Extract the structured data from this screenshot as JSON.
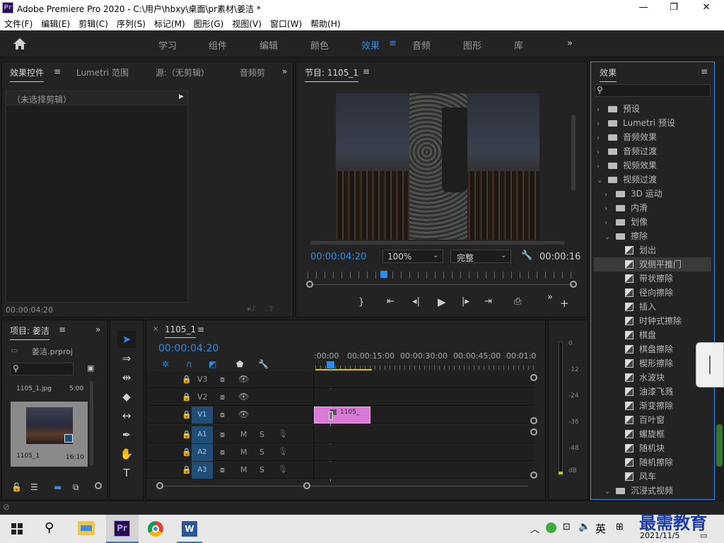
{
  "window": {
    "title": "Adobe Premiere Pro 2020 - C:\\用户\\hbxy\\桌面\\pr素材\\姜洁 *",
    "logo": "Pr"
  },
  "menu": [
    "文件(F)",
    "编辑(E)",
    "剪辑(C)",
    "序列(S)",
    "标记(M)",
    "图形(G)",
    "视图(V)",
    "窗口(W)",
    "帮助(H)"
  ],
  "workspaces": [
    "学习",
    "组件",
    "编辑",
    "颜色",
    "效果",
    "音频",
    "图形",
    "库"
  ],
  "source_panel": {
    "tabs": [
      "效果控件",
      "Lumetri 范围",
      "源:（无剪辑）",
      "音频剪"
    ],
    "no_clip": "（未选择剪辑）",
    "timecode": "00:00:04:20"
  },
  "program": {
    "title": "节目: 1105_1",
    "timecode": "00:00:04:20",
    "zoom": "100%",
    "quality": "完整",
    "duration": "00:00:16"
  },
  "project": {
    "title": "项目: 姜洁",
    "file": "姜洁.prproj",
    "thumb1_name": "1105_1.jpg",
    "thumb1_dur": "5:00",
    "thumb2_name": "1105_1",
    "thumb2_dur": "16:10"
  },
  "timeline": {
    "seq": "1105_1",
    "timecode": "00:00:04:20",
    "ruler": [
      ":00:00",
      "00:00:15:00",
      "00:00:30:00",
      "00:00:45:00",
      "00:01:0"
    ],
    "video_tracks": [
      "V3",
      "V2",
      "V1"
    ],
    "audio_tracks": [
      "A1",
      "A2",
      "A3"
    ],
    "clip_label": "1105_",
    "m": "M",
    "s": "S"
  },
  "meter": {
    "labels": [
      "0",
      "-12",
      "-24",
      "-36",
      "-48",
      "dB"
    ]
  },
  "effects": {
    "title": "效果",
    "items": [
      {
        "label": "预设",
        "level": 0,
        "kind": "preset"
      },
      {
        "label": "Lumetri 预设",
        "level": 0,
        "kind": "preset"
      },
      {
        "label": "音频效果",
        "level": 0,
        "kind": "folder"
      },
      {
        "label": "音频过渡",
        "level": 0,
        "kind": "folder"
      },
      {
        "label": "视频效果",
        "level": 0,
        "kind": "folder"
      },
      {
        "label": "视频过渡",
        "level": 0,
        "kind": "folder-open"
      },
      {
        "label": "3D 运动",
        "level": 1,
        "kind": "folder"
      },
      {
        "label": "内滑",
        "level": 1,
        "kind": "folder"
      },
      {
        "label": "划像",
        "level": 1,
        "kind": "folder"
      },
      {
        "label": "擦除",
        "level": 1,
        "kind": "folder-open"
      },
      {
        "label": "划出",
        "level": 2,
        "kind": "fx"
      },
      {
        "label": "双侧平推门",
        "level": 2,
        "kind": "fx",
        "selected": true
      },
      {
        "label": "带状擦除",
        "level": 2,
        "kind": "fx"
      },
      {
        "label": "径向擦除",
        "level": 2,
        "kind": "fx"
      },
      {
        "label": "插入",
        "level": 2,
        "kind": "fx"
      },
      {
        "label": "时钟式擦除",
        "level": 2,
        "kind": "fx"
      },
      {
        "label": "棋盘",
        "level": 2,
        "kind": "fx"
      },
      {
        "label": "棋盘擦除",
        "level": 2,
        "kind": "fx"
      },
      {
        "label": "楔形擦除",
        "level": 2,
        "kind": "fx"
      },
      {
        "label": "水波块",
        "level": 2,
        "kind": "fx"
      },
      {
        "label": "油漆飞溅",
        "level": 2,
        "kind": "fx"
      },
      {
        "label": "渐变擦除",
        "level": 2,
        "kind": "fx"
      },
      {
        "label": "百叶窗",
        "level": 2,
        "kind": "fx"
      },
      {
        "label": "螺旋框",
        "level": 2,
        "kind": "fx"
      },
      {
        "label": "随机块",
        "level": 2,
        "kind": "fx"
      },
      {
        "label": "随机擦除",
        "level": 2,
        "kind": "fx"
      },
      {
        "label": "风车",
        "level": 2,
        "kind": "fx"
      },
      {
        "label": "沉浸式视频",
        "level": 1,
        "kind": "folder-open"
      }
    ]
  },
  "taskbar": {
    "ime": "英",
    "date": "2021/11/5",
    "watermark": "最需教育"
  }
}
